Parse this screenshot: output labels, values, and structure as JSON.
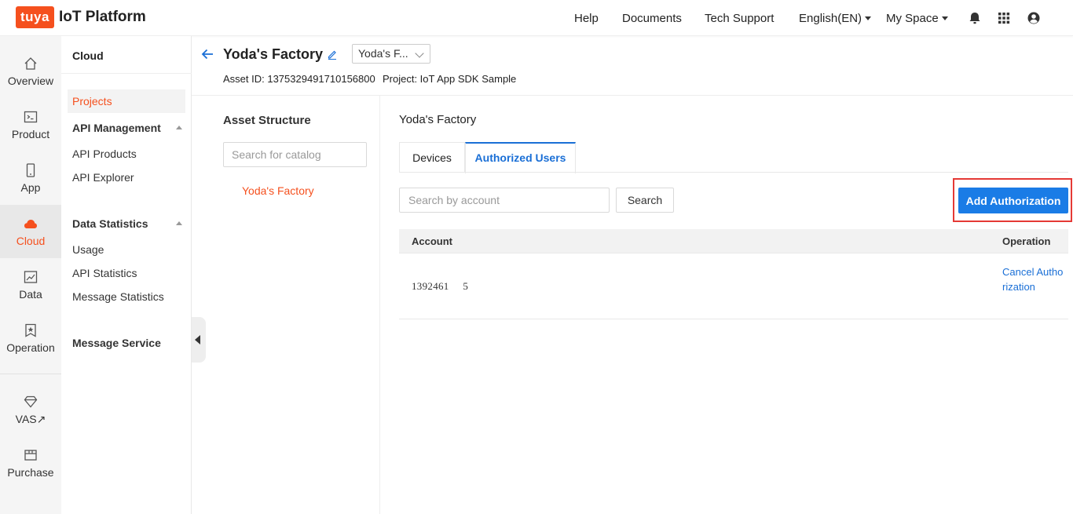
{
  "header": {
    "logo_badge": "tuya",
    "logo_text": "IoT Platform",
    "nav": [
      "Help",
      "Documents",
      "Tech Support"
    ],
    "language": "English(EN)",
    "space": "My Space"
  },
  "rail": {
    "items": [
      {
        "label": "Overview",
        "icon": "home-icon"
      },
      {
        "label": "Product",
        "icon": "terminal-icon"
      },
      {
        "label": "App",
        "icon": "phone-icon"
      },
      {
        "label": "Cloud",
        "icon": "cloud-icon",
        "active": true
      },
      {
        "label": "Data",
        "icon": "chart-icon"
      },
      {
        "label": "Operation",
        "icon": "bookmark-star-icon"
      },
      {
        "label": "VAS",
        "icon": "diamond-icon",
        "external": "↗"
      },
      {
        "label": "Purchase",
        "icon": "box-icon"
      }
    ]
  },
  "sidebar": {
    "title": "Cloud",
    "projects": "Projects",
    "api_management": "API Management",
    "api_products": "API Products",
    "api_explorer": "API Explorer",
    "data_statistics": "Data Statistics",
    "usage": "Usage",
    "api_statistics": "API Statistics",
    "message_statistics": "Message Statistics",
    "message_service": "Message Service"
  },
  "page": {
    "title": "Yoda's Factory",
    "asset_select": "Yoda's F...",
    "asset_id": "Asset ID: 1375329491710156800",
    "project": "Project: IoT App SDK Sample"
  },
  "structure": {
    "title": "Asset Structure",
    "search_placeholder": "Search for catalog",
    "node": "Yoda's Factory"
  },
  "main": {
    "title": "Yoda's Factory",
    "tabs": [
      "Devices",
      "Authorized Users"
    ],
    "search_placeholder": "Search by account",
    "search_button": "Search",
    "add_button": "Add Authorization",
    "columns": [
      "Account",
      "Operation"
    ],
    "rows": [
      {
        "account": "1392461     5",
        "operation": "Cancel Authorization"
      }
    ]
  },
  "colors": {
    "brand": "#f5501e",
    "primary": "#1a7ce6",
    "highlight": "#e53935"
  }
}
